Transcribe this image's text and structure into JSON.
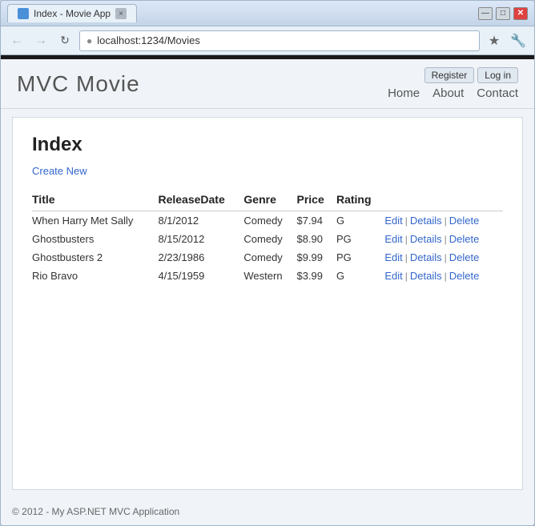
{
  "browser": {
    "tab_title": "Index - Movie App",
    "tab_close": "×",
    "url": "localhost:1234/Movies",
    "control_min": "—",
    "control_max": "□",
    "control_close": "✕"
  },
  "app": {
    "logo": "MVC Movie",
    "nav": {
      "home": "Home",
      "about": "About",
      "contact": "Contact"
    },
    "auth": {
      "register": "Register",
      "login": "Log in"
    }
  },
  "page": {
    "title": "Index",
    "create_new": "Create New",
    "columns": {
      "title": "Title",
      "release_date": "ReleaseDate",
      "genre": "Genre",
      "price": "Price",
      "rating": "Rating"
    },
    "rows": [
      {
        "title": "When Harry Met Sally",
        "release_date": "8/1/2012",
        "genre": "Comedy",
        "price": "$7.94",
        "rating": "G"
      },
      {
        "title": "Ghostbusters",
        "release_date": "8/15/2012",
        "genre": "Comedy",
        "price": "$8.90",
        "rating": "PG"
      },
      {
        "title": "Ghostbusters 2",
        "release_date": "2/23/1986",
        "genre": "Comedy",
        "price": "$9.99",
        "rating": "PG"
      },
      {
        "title": "Rio Bravo",
        "release_date": "4/15/1959",
        "genre": "Western",
        "price": "$3.99",
        "rating": "G"
      }
    ],
    "actions": {
      "edit": "Edit",
      "details": "Details",
      "delete": "Delete"
    },
    "footer": "© 2012 - My ASP.NET MVC Application"
  }
}
